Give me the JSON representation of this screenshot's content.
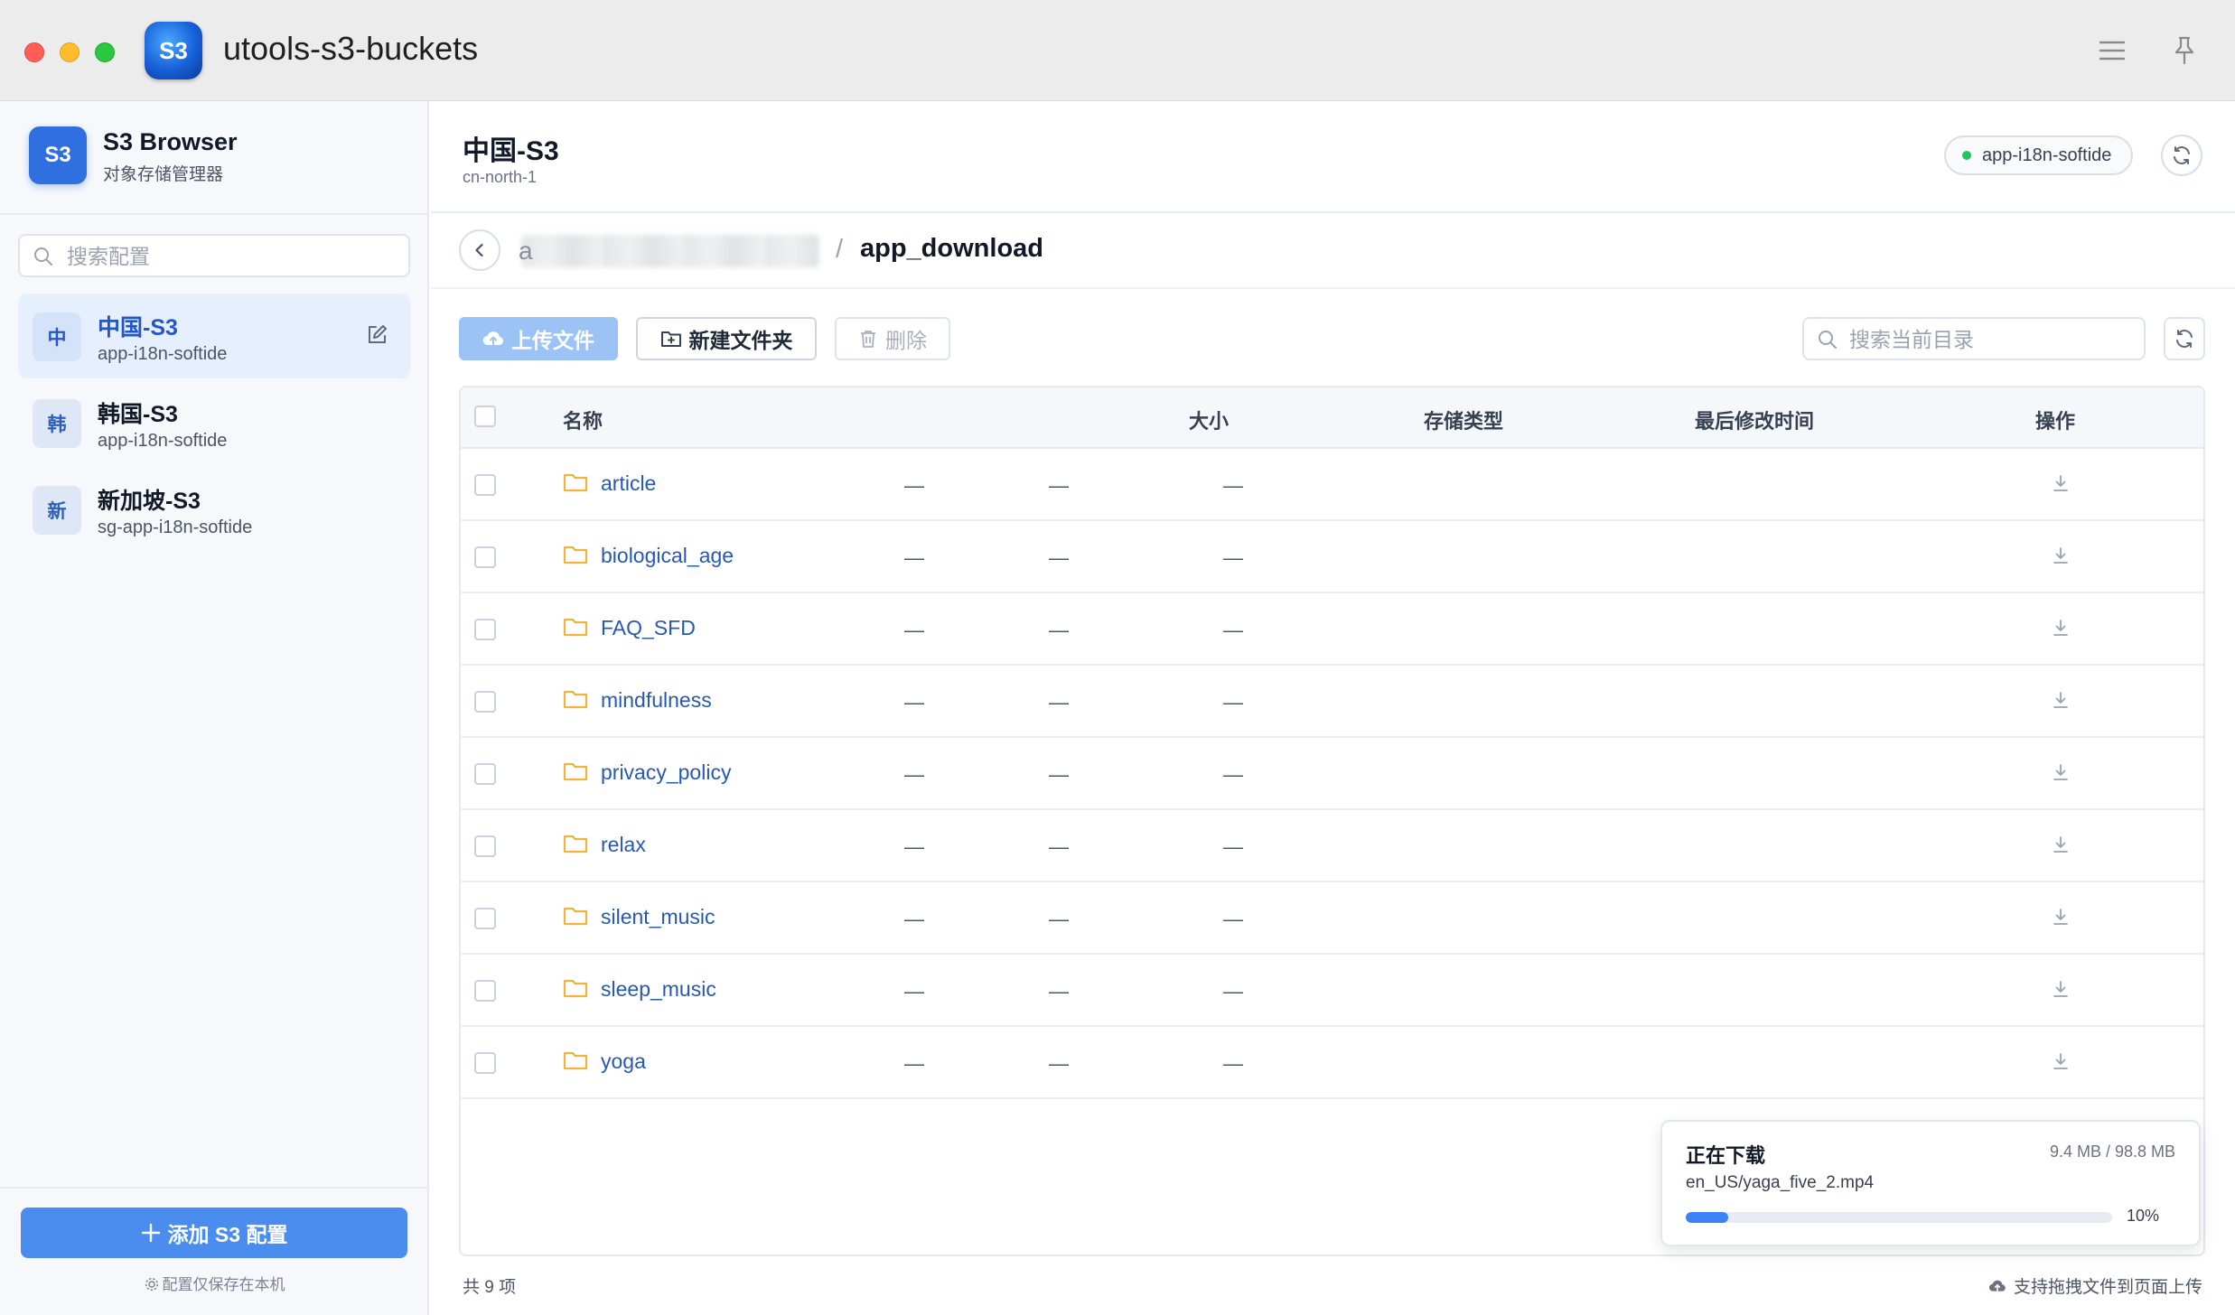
{
  "window": {
    "title": "utools-s3-buckets",
    "app_icon_text": "S3"
  },
  "sidebar": {
    "brand": {
      "logo_text": "S3",
      "name": "S3 Browser",
      "subtitle": "对象存储管理器"
    },
    "search": {
      "placeholder": "搜索配置",
      "value": ""
    },
    "configs": [
      {
        "badge": "中",
        "name": "中国-S3",
        "bucket": "app-i18n-softide",
        "active": true
      },
      {
        "badge": "韩",
        "name": "韩国-S3",
        "bucket": "app-i18n-softide",
        "active": false
      },
      {
        "badge": "新",
        "name": "新加坡-S3",
        "bucket": "sg-app-i18n-softide",
        "active": false
      }
    ],
    "add_button": "添加 S3 配置",
    "local_note": "配置仅保存在本机"
  },
  "main": {
    "title": "中国-S3",
    "region": "cn-north-1",
    "bucket_pill": "app-i18n-softide",
    "breadcrumb": {
      "first_initial": "a",
      "separator": "/",
      "current": "app_download"
    },
    "toolbar": {
      "upload": "上传文件",
      "new_folder": "新建文件夹",
      "delete": "删除",
      "search_placeholder": "搜索当前目录"
    },
    "table": {
      "headers": {
        "name": "名称",
        "size": "大小",
        "storage": "存储类型",
        "modified": "最后修改时间",
        "actions": "操作"
      },
      "rows": [
        {
          "name": "article",
          "size": "—",
          "storage": "—",
          "modified": "—"
        },
        {
          "name": "biological_age",
          "size": "—",
          "storage": "—",
          "modified": "—"
        },
        {
          "name": "FAQ_SFD",
          "size": "—",
          "storage": "—",
          "modified": "—"
        },
        {
          "name": "mindfulness",
          "size": "—",
          "storage": "—",
          "modified": "—"
        },
        {
          "name": "privacy_policy",
          "size": "—",
          "storage": "—",
          "modified": "—"
        },
        {
          "name": "relax",
          "size": "—",
          "storage": "—",
          "modified": "—"
        },
        {
          "name": "silent_music",
          "size": "—",
          "storage": "—",
          "modified": "—"
        },
        {
          "name": "sleep_music",
          "size": "—",
          "storage": "—",
          "modified": "—"
        },
        {
          "name": "yoga",
          "size": "—",
          "storage": "—",
          "modified": "—"
        }
      ]
    },
    "download": {
      "title": "正在下载",
      "size": "9.4 MB / 98.8 MB",
      "file": "en_US/yaga_five_2.mp4",
      "percent_label": "10%",
      "progress": 0.1
    },
    "footer": {
      "count": "共 9 项",
      "drag_hint": "支持拖拽文件到页面上传"
    }
  },
  "colors": {
    "accent": "#4a8def",
    "folder": "#f0b43d",
    "link": "#2858b5",
    "online": "#22c55e"
  }
}
